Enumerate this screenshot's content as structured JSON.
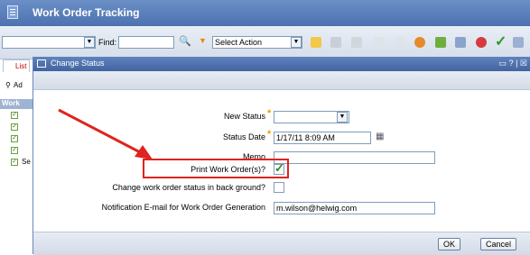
{
  "app": {
    "title": "Work Order Tracking"
  },
  "toolbar": {
    "find_label": "Find:",
    "find_value": "",
    "select_action": "Select Action"
  },
  "left_panel": {
    "tab_list": "List",
    "row_ad": "Ad",
    "row_work": "Work",
    "row_se": "Se"
  },
  "dialog": {
    "title": "Change Status",
    "controls": "? |",
    "fields": {
      "new_status_label": "New Status",
      "new_status_value": "",
      "status_date_label": "Status Date",
      "status_date_value": "1/17/11 8:09 AM",
      "memo_label": "Memo",
      "memo_value": "",
      "print_label": "Print Work Order(s)?",
      "print_checked": true,
      "background_label": "Change work order status in back ground?",
      "background_checked": false,
      "email_label": "Notification E-mail for Work Order Generation",
      "email_value": "m.wilson@helwig.com"
    },
    "buttons": {
      "ok": "OK",
      "cancel": "Cancel"
    }
  },
  "colors": {
    "annotation_red": "#e0231e",
    "required_orange": "#f59a00",
    "title_blue": "#4d72b0"
  }
}
